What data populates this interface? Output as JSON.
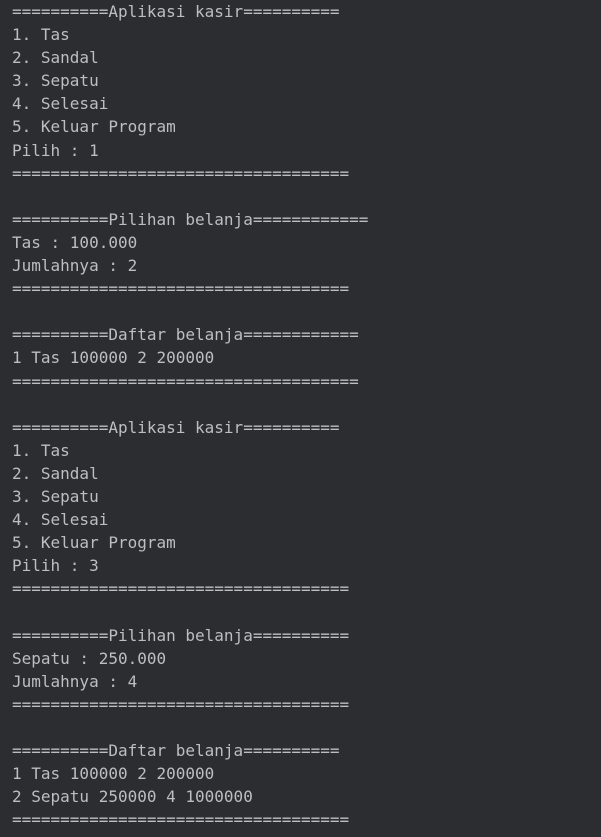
{
  "console": {
    "lines": [
      "==========Aplikasi kasir==========",
      "1. Tas",
      "2. Sandal",
      "3. Sepatu",
      "4. Selesai",
      "5. Keluar Program",
      "Pilih : 1",
      "===================================",
      "",
      "==========Pilihan belanja============",
      "Tas : 100.000",
      "Jumlahnya : 2",
      "===================================",
      "",
      "==========Daftar belanja============",
      "1 Tas 100000 2 200000",
      "====================================",
      "",
      "==========Aplikasi kasir==========",
      "1. Tas",
      "2. Sandal",
      "3. Sepatu",
      "4. Selesai",
      "5. Keluar Program",
      "Pilih : 3",
      "===================================",
      "",
      "==========Pilihan belanja==========",
      "Sepatu : 250.000",
      "Jumlahnya : 4",
      "===================================",
      "",
      "==========Daftar belanja==========",
      "1 Tas 100000 2 200000",
      "2 Sepatu 250000 4 1000000",
      "==================================="
    ]
  }
}
